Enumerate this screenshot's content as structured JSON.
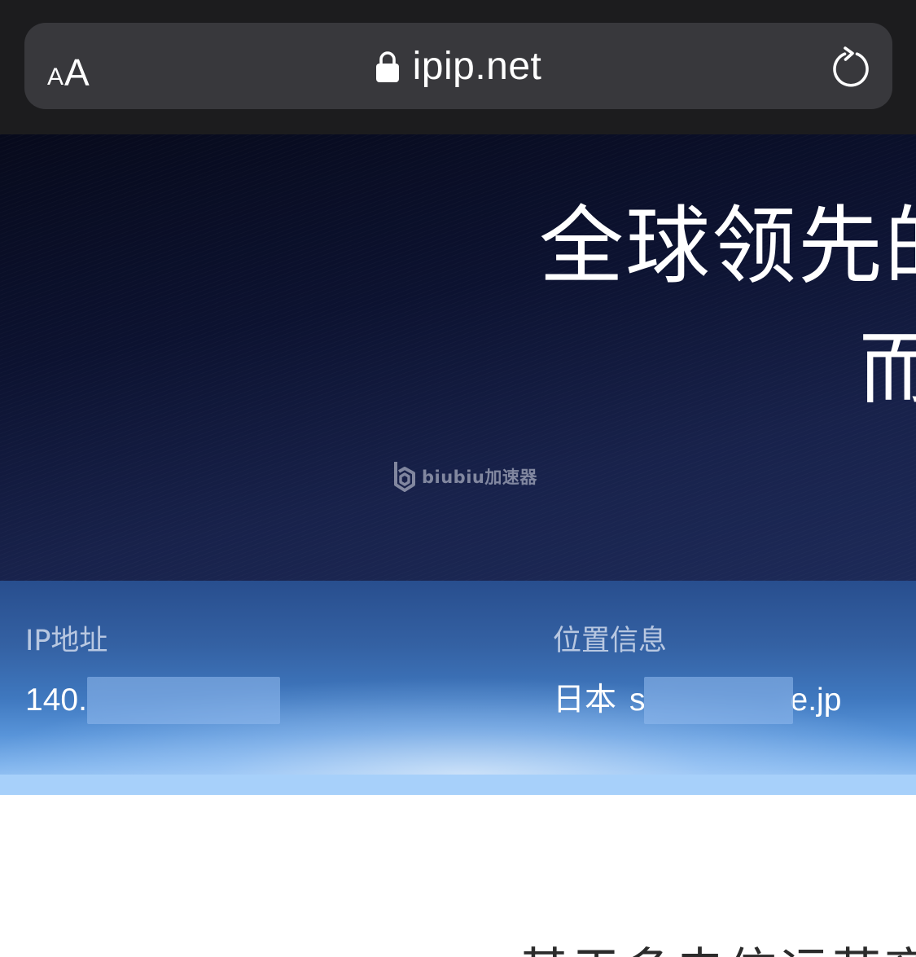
{
  "browser": {
    "text_size_button": {
      "small": "A",
      "large": "A"
    },
    "address": "ipip.net",
    "icons": {
      "secure": "lock-icon",
      "reload": "reload-icon"
    }
  },
  "hero": {
    "title": "全球领先的",
    "subtitle": "而",
    "watermark": "biubiu加速器"
  },
  "ip_info": {
    "ip_label": "IP地址",
    "ip_prefix": "140.",
    "location_label": "位置信息",
    "location_country": "日本",
    "location_lead": "s",
    "location_suffix": "e.jp"
  },
  "content": {
    "heading": "基于多电信运营商"
  },
  "colors": {
    "chrome_background": "#1c1c1e",
    "url_bar": "#38383c",
    "hero_dark": "#070a1c",
    "band_blue": "#3f78bf",
    "band_light": "#a9d1fa"
  }
}
